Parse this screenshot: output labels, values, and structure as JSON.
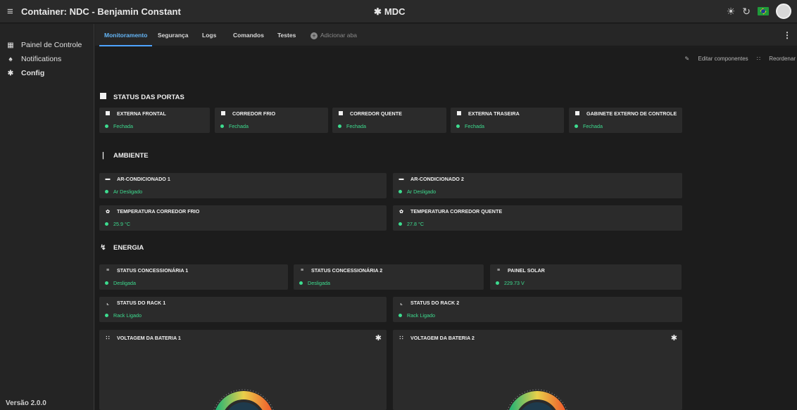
{
  "app": {
    "title": "Container: NDC - Benjamin Constant",
    "center_title": "MDC",
    "version": "Versão 2.0.0"
  },
  "sidebar": {
    "items": [
      {
        "label": "Painel de Controle",
        "icon": "dashboard-icon"
      },
      {
        "label": "Notifications",
        "icon": "bell-icon"
      },
      {
        "label": "Config",
        "icon": "gear-icon"
      }
    ]
  },
  "tabs": {
    "items": [
      "Monitoramento",
      "Segurança",
      "Logs",
      "Comandos",
      "Testes"
    ],
    "add_label": "Adicionar aba",
    "active": "Monitoramento"
  },
  "toolbar": {
    "edit_label": "Editar componentes",
    "reorder_label": "Reordenar"
  },
  "sections": {
    "doors": {
      "title": "STATUS DAS PORTAS",
      "cards": [
        {
          "name": "EXTERNA FRONTAL",
          "status": "Fechada"
        },
        {
          "name": "CORREDOR FRIO",
          "status": "Fechada"
        },
        {
          "name": "CORREDOR QUENTE",
          "status": "Fechada"
        },
        {
          "name": "EXTERNA TRASEIRA",
          "status": "Fechada"
        },
        {
          "name": "GABINETE EXTERNO DE CONTROLE",
          "status": "Fechada"
        }
      ]
    },
    "environment": {
      "title": "AMBIENTE",
      "cards": [
        {
          "name": "AR-CONDICIONADO 1",
          "status": "Ar Desligado"
        },
        {
          "name": "AR-CONDICIONADO 2",
          "status": "Ar Desligado"
        },
        {
          "name": "TEMPERATURA CORREDOR FRIO",
          "status": "25.9 °C"
        },
        {
          "name": "TEMPERATURA CORREDOR QUENTE",
          "status": "27.8 °C"
        }
      ]
    },
    "energy": {
      "title": "ENERGIA",
      "cards": [
        {
          "name": "STATUS CONCESSIONÁRIA 1",
          "status": "Desligada"
        },
        {
          "name": "STATUS CONCESSIONÁRIA 2",
          "status": "Desligada"
        },
        {
          "name": "PAINEL SOLAR",
          "status": "229.73 V"
        },
        {
          "name": "STATUS DO RACK 1",
          "status": "Rack Ligado"
        },
        {
          "name": "STATUS DO RACK 2",
          "status": "Rack Ligado"
        }
      ],
      "gauges": [
        {
          "name": "VOLTAGEM DA BATERIA 1"
        },
        {
          "name": "VOLTAGEM DA BATERIA 2"
        }
      ]
    }
  },
  "colors": {
    "accent": "#4da3ff",
    "status_green": "#3ddc8f",
    "card_bg": "#2b2b2b"
  }
}
